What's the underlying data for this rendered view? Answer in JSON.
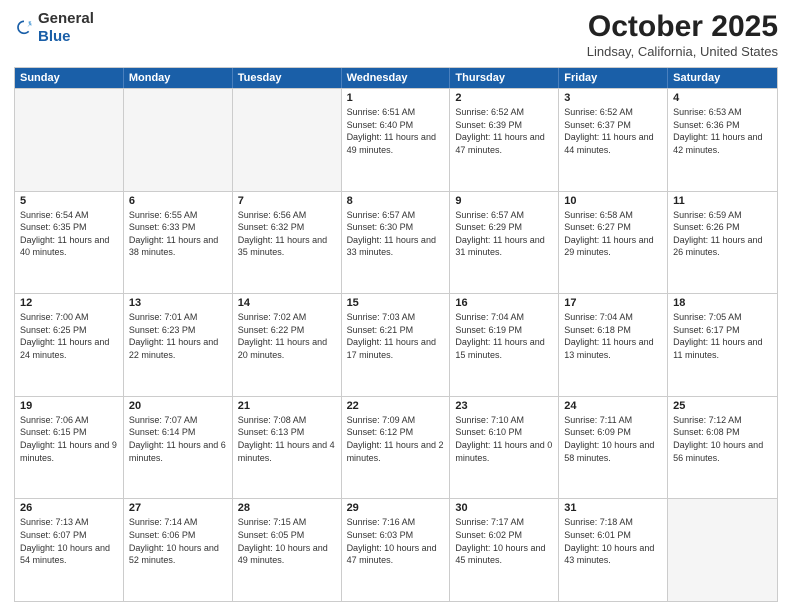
{
  "header": {
    "logo": {
      "general": "General",
      "blue": "Blue"
    },
    "title": "October 2025",
    "location": "Lindsay, California, United States"
  },
  "days_of_week": [
    "Sunday",
    "Monday",
    "Tuesday",
    "Wednesday",
    "Thursday",
    "Friday",
    "Saturday"
  ],
  "weeks": [
    [
      {
        "day": "",
        "sunrise": "",
        "sunset": "",
        "daylight": "",
        "empty": true
      },
      {
        "day": "",
        "sunrise": "",
        "sunset": "",
        "daylight": "",
        "empty": true
      },
      {
        "day": "",
        "sunrise": "",
        "sunset": "",
        "daylight": "",
        "empty": true
      },
      {
        "day": "1",
        "sunrise": "Sunrise: 6:51 AM",
        "sunset": "Sunset: 6:40 PM",
        "daylight": "Daylight: 11 hours and 49 minutes.",
        "empty": false
      },
      {
        "day": "2",
        "sunrise": "Sunrise: 6:52 AM",
        "sunset": "Sunset: 6:39 PM",
        "daylight": "Daylight: 11 hours and 47 minutes.",
        "empty": false
      },
      {
        "day": "3",
        "sunrise": "Sunrise: 6:52 AM",
        "sunset": "Sunset: 6:37 PM",
        "daylight": "Daylight: 11 hours and 44 minutes.",
        "empty": false
      },
      {
        "day": "4",
        "sunrise": "Sunrise: 6:53 AM",
        "sunset": "Sunset: 6:36 PM",
        "daylight": "Daylight: 11 hours and 42 minutes.",
        "empty": false
      }
    ],
    [
      {
        "day": "5",
        "sunrise": "Sunrise: 6:54 AM",
        "sunset": "Sunset: 6:35 PM",
        "daylight": "Daylight: 11 hours and 40 minutes.",
        "empty": false
      },
      {
        "day": "6",
        "sunrise": "Sunrise: 6:55 AM",
        "sunset": "Sunset: 6:33 PM",
        "daylight": "Daylight: 11 hours and 38 minutes.",
        "empty": false
      },
      {
        "day": "7",
        "sunrise": "Sunrise: 6:56 AM",
        "sunset": "Sunset: 6:32 PM",
        "daylight": "Daylight: 11 hours and 35 minutes.",
        "empty": false
      },
      {
        "day": "8",
        "sunrise": "Sunrise: 6:57 AM",
        "sunset": "Sunset: 6:30 PM",
        "daylight": "Daylight: 11 hours and 33 minutes.",
        "empty": false
      },
      {
        "day": "9",
        "sunrise": "Sunrise: 6:57 AM",
        "sunset": "Sunset: 6:29 PM",
        "daylight": "Daylight: 11 hours and 31 minutes.",
        "empty": false
      },
      {
        "day": "10",
        "sunrise": "Sunrise: 6:58 AM",
        "sunset": "Sunset: 6:27 PM",
        "daylight": "Daylight: 11 hours and 29 minutes.",
        "empty": false
      },
      {
        "day": "11",
        "sunrise": "Sunrise: 6:59 AM",
        "sunset": "Sunset: 6:26 PM",
        "daylight": "Daylight: 11 hours and 26 minutes.",
        "empty": false
      }
    ],
    [
      {
        "day": "12",
        "sunrise": "Sunrise: 7:00 AM",
        "sunset": "Sunset: 6:25 PM",
        "daylight": "Daylight: 11 hours and 24 minutes.",
        "empty": false
      },
      {
        "day": "13",
        "sunrise": "Sunrise: 7:01 AM",
        "sunset": "Sunset: 6:23 PM",
        "daylight": "Daylight: 11 hours and 22 minutes.",
        "empty": false
      },
      {
        "day": "14",
        "sunrise": "Sunrise: 7:02 AM",
        "sunset": "Sunset: 6:22 PM",
        "daylight": "Daylight: 11 hours and 20 minutes.",
        "empty": false
      },
      {
        "day": "15",
        "sunrise": "Sunrise: 7:03 AM",
        "sunset": "Sunset: 6:21 PM",
        "daylight": "Daylight: 11 hours and 17 minutes.",
        "empty": false
      },
      {
        "day": "16",
        "sunrise": "Sunrise: 7:04 AM",
        "sunset": "Sunset: 6:19 PM",
        "daylight": "Daylight: 11 hours and 15 minutes.",
        "empty": false
      },
      {
        "day": "17",
        "sunrise": "Sunrise: 7:04 AM",
        "sunset": "Sunset: 6:18 PM",
        "daylight": "Daylight: 11 hours and 13 minutes.",
        "empty": false
      },
      {
        "day": "18",
        "sunrise": "Sunrise: 7:05 AM",
        "sunset": "Sunset: 6:17 PM",
        "daylight": "Daylight: 11 hours and 11 minutes.",
        "empty": false
      }
    ],
    [
      {
        "day": "19",
        "sunrise": "Sunrise: 7:06 AM",
        "sunset": "Sunset: 6:15 PM",
        "daylight": "Daylight: 11 hours and 9 minutes.",
        "empty": false
      },
      {
        "day": "20",
        "sunrise": "Sunrise: 7:07 AM",
        "sunset": "Sunset: 6:14 PM",
        "daylight": "Daylight: 11 hours and 6 minutes.",
        "empty": false
      },
      {
        "day": "21",
        "sunrise": "Sunrise: 7:08 AM",
        "sunset": "Sunset: 6:13 PM",
        "daylight": "Daylight: 11 hours and 4 minutes.",
        "empty": false
      },
      {
        "day": "22",
        "sunrise": "Sunrise: 7:09 AM",
        "sunset": "Sunset: 6:12 PM",
        "daylight": "Daylight: 11 hours and 2 minutes.",
        "empty": false
      },
      {
        "day": "23",
        "sunrise": "Sunrise: 7:10 AM",
        "sunset": "Sunset: 6:10 PM",
        "daylight": "Daylight: 11 hours and 0 minutes.",
        "empty": false
      },
      {
        "day": "24",
        "sunrise": "Sunrise: 7:11 AM",
        "sunset": "Sunset: 6:09 PM",
        "daylight": "Daylight: 10 hours and 58 minutes.",
        "empty": false
      },
      {
        "day": "25",
        "sunrise": "Sunrise: 7:12 AM",
        "sunset": "Sunset: 6:08 PM",
        "daylight": "Daylight: 10 hours and 56 minutes.",
        "empty": false
      }
    ],
    [
      {
        "day": "26",
        "sunrise": "Sunrise: 7:13 AM",
        "sunset": "Sunset: 6:07 PM",
        "daylight": "Daylight: 10 hours and 54 minutes.",
        "empty": false
      },
      {
        "day": "27",
        "sunrise": "Sunrise: 7:14 AM",
        "sunset": "Sunset: 6:06 PM",
        "daylight": "Daylight: 10 hours and 52 minutes.",
        "empty": false
      },
      {
        "day": "28",
        "sunrise": "Sunrise: 7:15 AM",
        "sunset": "Sunset: 6:05 PM",
        "daylight": "Daylight: 10 hours and 49 minutes.",
        "empty": false
      },
      {
        "day": "29",
        "sunrise": "Sunrise: 7:16 AM",
        "sunset": "Sunset: 6:03 PM",
        "daylight": "Daylight: 10 hours and 47 minutes.",
        "empty": false
      },
      {
        "day": "30",
        "sunrise": "Sunrise: 7:17 AM",
        "sunset": "Sunset: 6:02 PM",
        "daylight": "Daylight: 10 hours and 45 minutes.",
        "empty": false
      },
      {
        "day": "31",
        "sunrise": "Sunrise: 7:18 AM",
        "sunset": "Sunset: 6:01 PM",
        "daylight": "Daylight: 10 hours and 43 minutes.",
        "empty": false
      },
      {
        "day": "",
        "sunrise": "",
        "sunset": "",
        "daylight": "",
        "empty": true
      }
    ]
  ]
}
